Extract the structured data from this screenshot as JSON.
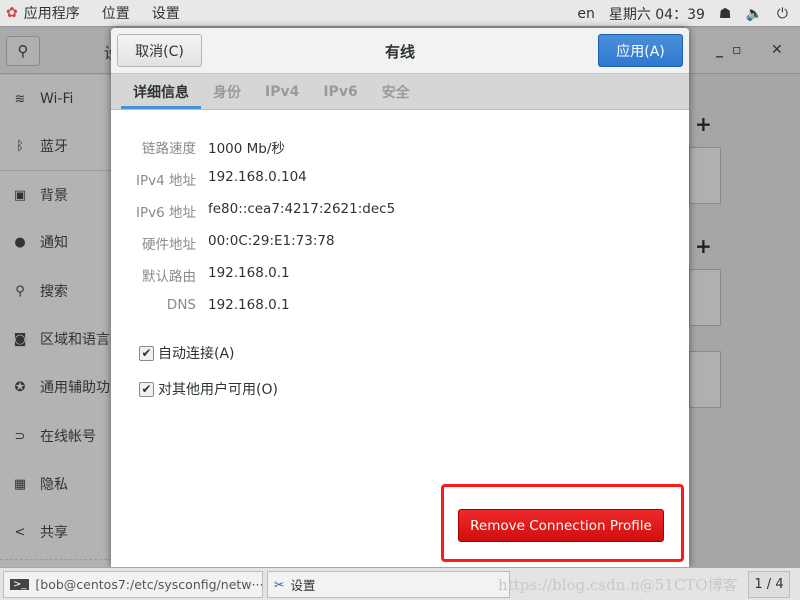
{
  "topbar": {
    "apps": "应用程序",
    "places": "位置",
    "settings": "设置",
    "lang": "en",
    "clock": "星期六 04：39"
  },
  "app": {
    "title": "设置",
    "sidebar": [
      {
        "icon": "wifi-icon",
        "glyph": "≋",
        "label": "Wi-Fi"
      },
      {
        "icon": "bluetooth-icon",
        "glyph": "ᛒ",
        "label": "蓝牙"
      },
      {
        "icon": "background-icon",
        "glyph": "▣",
        "label": "背景"
      },
      {
        "icon": "notification-icon",
        "glyph": "●",
        "label": "通知"
      },
      {
        "icon": "search-icon",
        "glyph": "⚲",
        "label": "搜索"
      },
      {
        "icon": "region-icon",
        "glyph": "◙",
        "label": "区域和语言"
      },
      {
        "icon": "accessibility-icon",
        "glyph": "✪",
        "label": "通用辅助功能"
      },
      {
        "icon": "online-accounts-icon",
        "glyph": "⊃",
        "label": "在线帐号"
      },
      {
        "icon": "privacy-icon",
        "glyph": "▦",
        "label": "隐私"
      },
      {
        "icon": "share-icon",
        "glyph": "<",
        "label": "共享"
      }
    ]
  },
  "dialog": {
    "title": "有线",
    "cancel": "取消(C)",
    "apply": "应用(A)",
    "tabs": [
      "详细信息",
      "身份",
      "IPv4",
      "IPv6",
      "安全"
    ],
    "details": [
      {
        "label": "链路速度",
        "value": "1000 Mb/秒"
      },
      {
        "label": "IPv4 地址",
        "value": "192.168.0.104"
      },
      {
        "label": "IPv6 地址",
        "value": "fe80::cea7:4217:2621:dec5"
      },
      {
        "label": "硬件地址",
        "value": "00:0C:29:E1:73:78"
      },
      {
        "label": "默认路由",
        "value": "192.168.0.1"
      },
      {
        "label": "DNS",
        "value": "192.168.0.1"
      }
    ],
    "auto_connect": {
      "label": "自动连接(A)",
      "checked": true
    },
    "all_users": {
      "label": "对其他用户可用(O)",
      "checked": true
    },
    "remove": "Remove Connection Profile",
    "highlight_color": "#ff1a1a"
  },
  "taskbar": {
    "terminal": "[bob@centos7:/etc/sysconfig/netw···",
    "settings": "设置",
    "pager": "1 / 4",
    "watermark": "https://blog.csdn.n@51CTO博客"
  }
}
